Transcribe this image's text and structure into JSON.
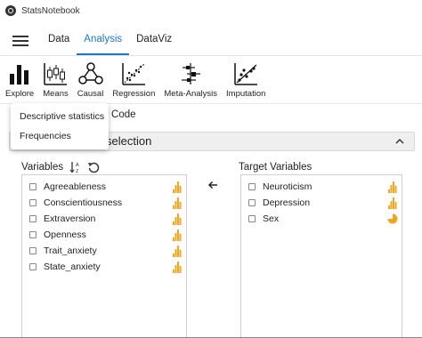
{
  "app": {
    "title": "StatsNotebook"
  },
  "nav": {
    "tabs": [
      {
        "label": "Data",
        "active": false
      },
      {
        "label": "Analysis",
        "active": true
      },
      {
        "label": "DataViz",
        "active": false
      }
    ]
  },
  "toolbar": {
    "tools": [
      {
        "label": "Explore",
        "icon": "bar-chart-icon"
      },
      {
        "label": "Means",
        "icon": "boxplot-icon"
      },
      {
        "label": "Causal",
        "icon": "causal-graph-icon"
      },
      {
        "label": "Regression",
        "icon": "scatter-plot-icon"
      },
      {
        "label": "Meta-Analysis",
        "icon": "forest-plot-icon"
      },
      {
        "label": "Imputation",
        "icon": "imputation-scatter-icon"
      }
    ]
  },
  "dropdown": {
    "items": [
      "Descriptive statistics",
      "Frequencies"
    ]
  },
  "subhead": {
    "text": "r Code"
  },
  "panel": {
    "title": "selection"
  },
  "variables": {
    "label": "Variables",
    "items": [
      {
        "name": "Agreeableness",
        "type": "numeric"
      },
      {
        "name": "Conscientiousness",
        "type": "numeric"
      },
      {
        "name": "Extraversion",
        "type": "numeric"
      },
      {
        "name": "Openness",
        "type": "numeric"
      },
      {
        "name": "Trait_anxiety",
        "type": "numeric"
      },
      {
        "name": "State_anxiety",
        "type": "numeric"
      }
    ]
  },
  "target": {
    "label": "Target Variables",
    "items": [
      {
        "name": "Neuroticism",
        "type": "numeric"
      },
      {
        "name": "Depression",
        "type": "numeric"
      },
      {
        "name": "Sex",
        "type": "factor"
      }
    ]
  },
  "colors": {
    "accent": "#1976d2",
    "type_icon": "#f2a61e"
  }
}
